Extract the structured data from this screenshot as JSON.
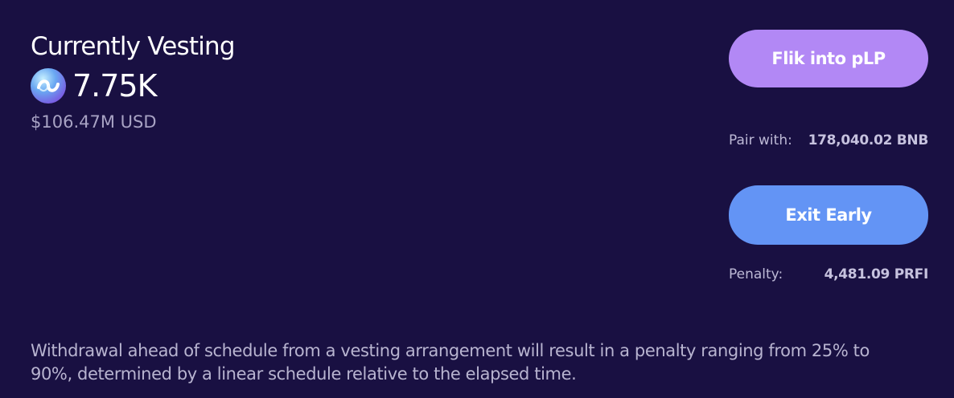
{
  "vesting": {
    "title": "Currently Vesting",
    "token_icon": "token-logo-icon",
    "amount": "7.75K",
    "usd_value": "$106.47M USD"
  },
  "actions": {
    "pair_button_label": "Flik into pLP",
    "pair_with_label": "Pair with:",
    "pair_with_value": "178,040.02 BNB",
    "exit_button_label": "Exit Early",
    "penalty_label": "Penalty:",
    "penalty_value": "4,481.09 PRFI"
  },
  "note": "Withdrawal ahead of schedule from a vesting arrangement will result in a penalty ranging from 25% to 90%, determined by a linear schedule relative to the elapsed time.",
  "colors": {
    "background": "#191042",
    "pair_button": "#b288f5",
    "exit_button": "#6394f5",
    "muted_text": "#a8a3c4"
  }
}
